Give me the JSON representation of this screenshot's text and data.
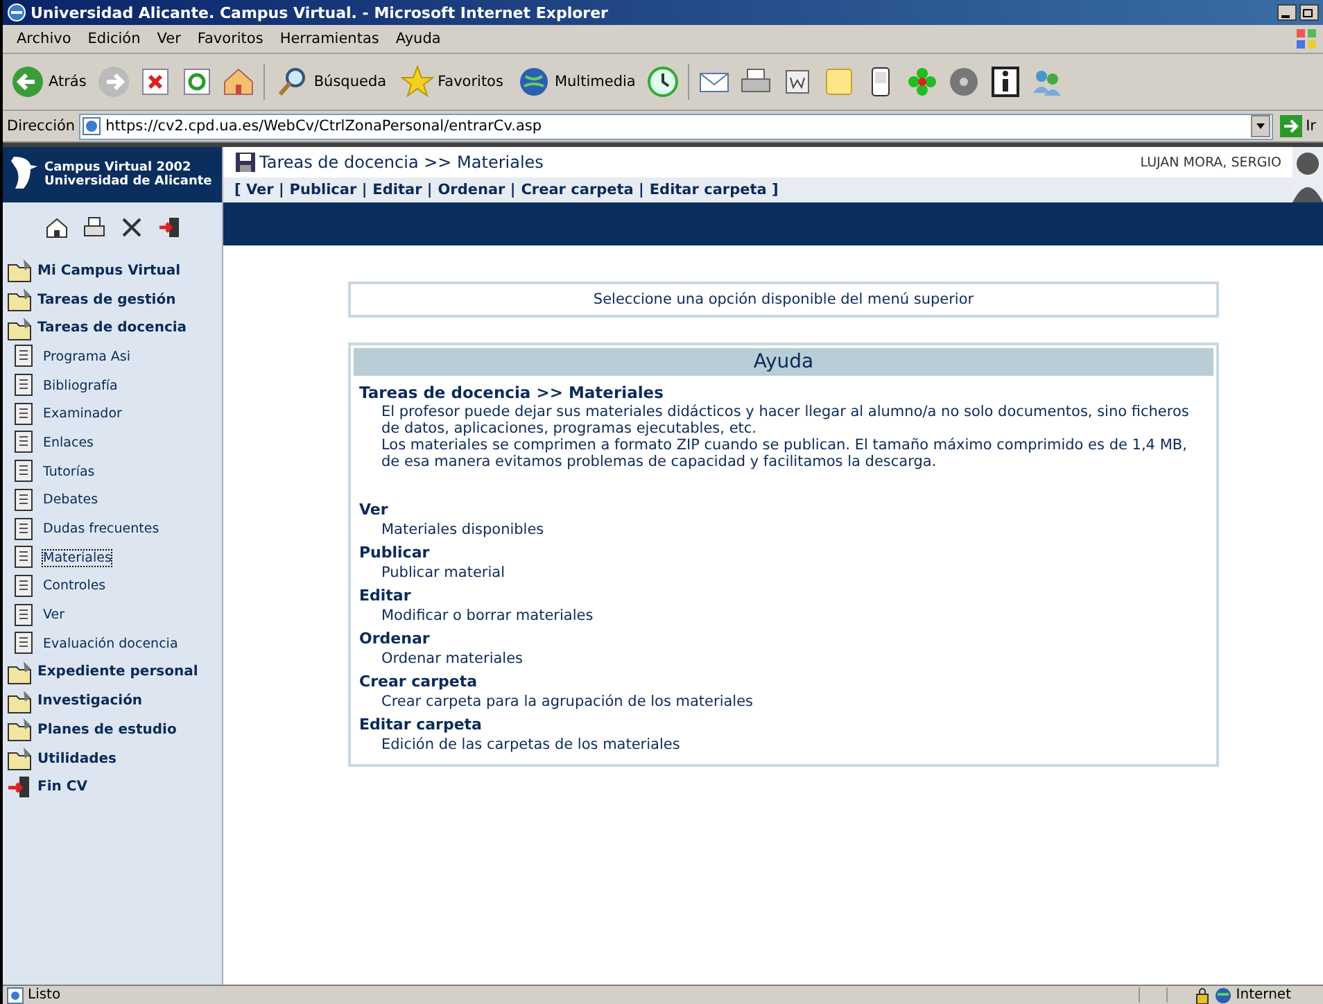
{
  "window": {
    "title": "Universidad Alicante. Campus Virtual. - Microsoft Internet Explorer"
  },
  "menu": [
    "Archivo",
    "Edición",
    "Ver",
    "Favoritos",
    "Herramientas",
    "Ayuda"
  ],
  "toolbar": [
    {
      "kind": "back",
      "label": "Atrás"
    },
    {
      "kind": "forward"
    },
    {
      "kind": "stop"
    },
    {
      "kind": "refresh"
    },
    {
      "kind": "home"
    },
    {
      "kind": "search",
      "label": "Búsqueda"
    },
    {
      "kind": "favorites",
      "label": "Favoritos"
    },
    {
      "kind": "media",
      "label": "Multimedia"
    },
    {
      "kind": "history"
    },
    {
      "kind": "mail"
    },
    {
      "kind": "print"
    },
    {
      "kind": "edit"
    },
    {
      "kind": "note"
    },
    {
      "kind": "device"
    },
    {
      "kind": "flower"
    },
    {
      "kind": "disc"
    },
    {
      "kind": "info"
    },
    {
      "kind": "people"
    }
  ],
  "address": {
    "label": "Dirección",
    "value": "https://cv2.cpd.ua.es/WebCv/CtrlZonaPersonal/entrarCv.asp",
    "go": "Ir"
  },
  "site": {
    "name": "Campus Virtual 2002",
    "org": "Universidad de Alicante"
  },
  "header": {
    "title": "Tareas de docencia >> Materiales",
    "user": "LUJAN MORA, SERGIO",
    "links": [
      "[ Ver |",
      "Publicar |",
      "Editar |",
      "Ordenar |",
      "Crear carpeta |",
      "Editar carpeta ]"
    ]
  },
  "sidebar": {
    "tools": [
      {
        "kind": "home"
      },
      {
        "kind": "print"
      },
      {
        "kind": "tools"
      },
      {
        "kind": "exit"
      }
    ],
    "items": [
      {
        "kind": "section",
        "label": "Mi Campus Virtual",
        "selected": false
      },
      {
        "kind": "section",
        "label": "Tareas de gestión",
        "selected": false
      },
      {
        "kind": "section",
        "label": "Tareas de docencia",
        "selected": false
      },
      {
        "kind": "sub",
        "label": "Programa Asi",
        "selected": false
      },
      {
        "kind": "sub",
        "label": "Bibliografía",
        "selected": false
      },
      {
        "kind": "sub",
        "label": "Examinador",
        "selected": false
      },
      {
        "kind": "sub",
        "label": "Enlaces",
        "selected": false
      },
      {
        "kind": "sub",
        "label": "Tutorías",
        "selected": false
      },
      {
        "kind": "sub",
        "label": "Debates",
        "selected": false
      },
      {
        "kind": "sub",
        "label": "Dudas frecuentes",
        "selected": false
      },
      {
        "kind": "sub",
        "label": "Materiales",
        "selected": true
      },
      {
        "kind": "sub",
        "label": "Controles",
        "selected": false
      },
      {
        "kind": "sub",
        "label": "Ver",
        "selected": false
      },
      {
        "kind": "sub",
        "label": "Evaluación docencia",
        "selected": false
      },
      {
        "kind": "section",
        "label": "Expediente personal",
        "selected": false
      },
      {
        "kind": "section",
        "label": "Investigación",
        "selected": false
      },
      {
        "kind": "section",
        "label": "Planes de estudio",
        "selected": false
      },
      {
        "kind": "section",
        "label": "Utilidades",
        "selected": false
      },
      {
        "kind": "exit",
        "label": "Fin CV",
        "selected": false
      }
    ]
  },
  "notice": "Seleccione una opción disponible del menú superior",
  "help": {
    "title": "Ayuda",
    "heading": "Tareas de docencia >> Materiales",
    "paragraphs": [
      "El profesor puede dejar sus materiales didácticos y hacer llegar al alumno/a no solo documentos, sino ficheros de datos, aplicaciones, programas ejecutables, etc.",
      "Los materiales se comprimen a formato ZIP cuando se publican. El tamaño máximo comprimido es de 1,4 MB, de esa manera evitamos problemas de capacidad y facilitamos la descarga."
    ],
    "sections": [
      {
        "title": "Ver",
        "text": "Materiales disponibles"
      },
      {
        "title": "Publicar",
        "text": "Publicar material"
      },
      {
        "title": "Editar",
        "text": "Modificar o borrar materiales"
      },
      {
        "title": "Ordenar",
        "text": "Ordenar materiales"
      },
      {
        "title": "Crear carpeta",
        "text": "Crear carpeta para la agrupación de los materiales"
      },
      {
        "title": "Editar carpeta",
        "text": "Edición de las carpetas de los materiales"
      }
    ]
  },
  "status_bar": {
    "text": "Listo",
    "zone": "Internet"
  }
}
